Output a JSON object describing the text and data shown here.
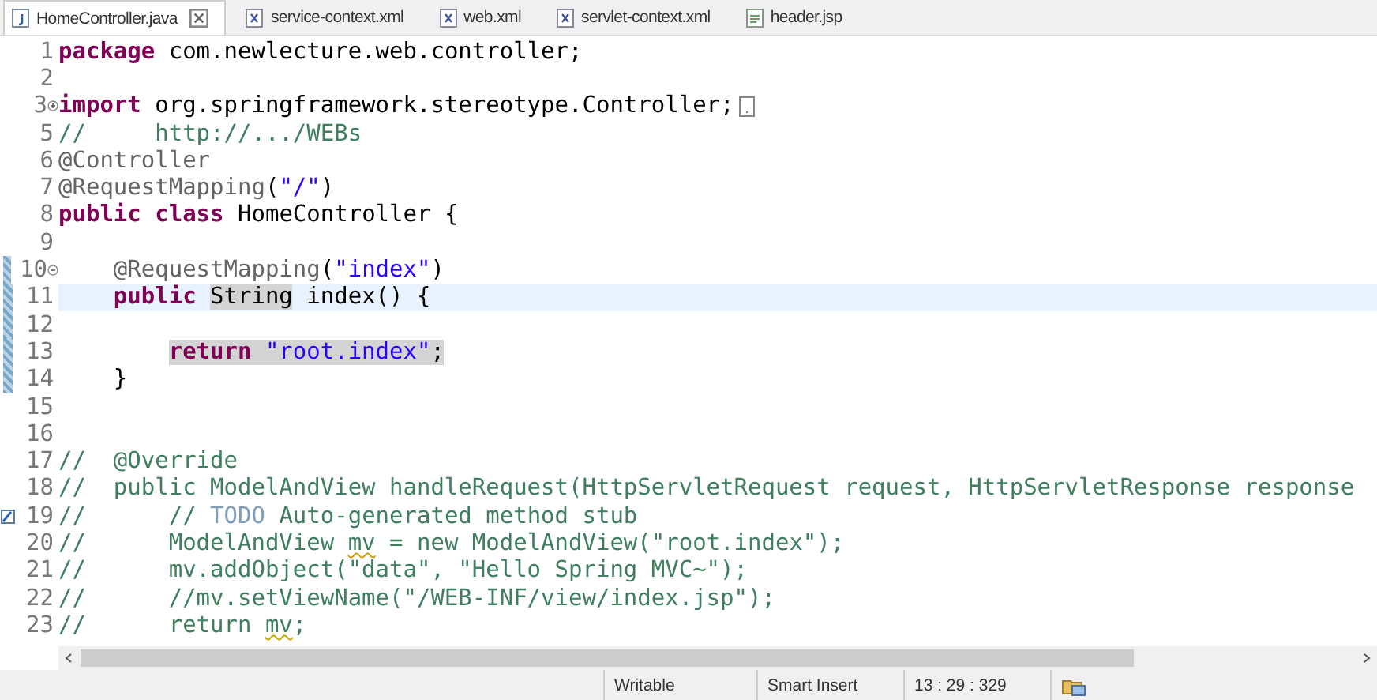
{
  "tabs": [
    {
      "label": "HomeController.java",
      "kind": "java",
      "selected": true
    },
    {
      "label": "service-context.xml",
      "kind": "xml",
      "selected": false
    },
    {
      "label": "web.xml",
      "kind": "xml",
      "selected": false
    },
    {
      "label": "servlet-context.xml",
      "kind": "xml",
      "selected": false
    },
    {
      "label": "header.jsp",
      "kind": "jsp",
      "selected": false
    }
  ],
  "editor": {
    "lines": [
      {
        "number": "1",
        "current": false,
        "changed": false,
        "tokens": [
          {
            "kind": "kw",
            "text": "package ",
            "highlighted": false,
            "warning": false
          },
          {
            "kind": "plain",
            "text": "com.newlecture.web.controller;",
            "highlighted": false,
            "warning": false
          }
        ]
      },
      {
        "number": "2",
        "current": false,
        "changed": false
      },
      {
        "number": "3",
        "current": false,
        "changed": false,
        "collapsed": true,
        "tokens": [
          {
            "kind": "kw",
            "text": "import ",
            "highlighted": false,
            "warning": false
          },
          {
            "kind": "plain",
            "text": "org.springframework.stereotype.Controller;",
            "highlighted": false,
            "warning": false
          }
        ]
      },
      {
        "number": "5",
        "current": false,
        "changed": false,
        "tokens": [
          {
            "kind": "comment",
            "text": "//     http://.../WEBs",
            "highlighted": false,
            "warning": false
          }
        ]
      },
      {
        "number": "6",
        "current": false,
        "changed": false,
        "tokens": [
          {
            "kind": "ann",
            "text": "@Controller",
            "highlighted": false,
            "warning": false
          }
        ]
      },
      {
        "number": "7",
        "current": false,
        "changed": false,
        "tokens": [
          {
            "kind": "ann",
            "text": "@RequestMapping",
            "highlighted": false,
            "warning": false
          },
          {
            "kind": "plain",
            "text": "(",
            "highlighted": false,
            "warning": false
          },
          {
            "kind": "str",
            "text": "\"/\"",
            "highlighted": false,
            "warning": false
          },
          {
            "kind": "plain",
            "text": ")",
            "highlighted": false,
            "warning": false
          }
        ]
      },
      {
        "number": "8",
        "current": false,
        "changed": false,
        "tokens": [
          {
            "kind": "kw",
            "text": "public class ",
            "highlighted": false,
            "warning": false
          },
          {
            "kind": "plain",
            "text": "HomeController {",
            "highlighted": false,
            "warning": false
          }
        ]
      },
      {
        "number": "9",
        "current": false,
        "changed": false
      },
      {
        "number": "10",
        "current": false,
        "changed": true,
        "collapsed": false,
        "tokens": [
          {
            "kind": "ann",
            "text": "    @RequestMapping",
            "highlighted": false,
            "warning": false
          },
          {
            "kind": "plain",
            "text": "(",
            "highlighted": false,
            "warning": false
          },
          {
            "kind": "str",
            "text": "\"index\"",
            "highlighted": false,
            "warning": false
          },
          {
            "kind": "plain",
            "text": ")",
            "highlighted": false,
            "warning": false
          }
        ]
      },
      {
        "number": "11",
        "current": true,
        "changed": true,
        "tokens": [
          {
            "kind": "kw",
            "text": "    public ",
            "highlighted": false,
            "warning": false
          },
          {
            "kind": "plain",
            "text": "String",
            "highlighted": true,
            "warning": false
          },
          {
            "kind": "plain",
            "text": " index() {",
            "highlighted": false,
            "warning": false
          }
        ]
      },
      {
        "number": "12",
        "current": false,
        "changed": true
      },
      {
        "number": "13",
        "current": false,
        "changed": true,
        "tokens": [
          {
            "kind": "kw",
            "text": "        return ",
            "highlighted": true,
            "warning": false
          },
          {
            "kind": "str",
            "text": "\"root.index\"",
            "highlighted": true,
            "warning": false
          },
          {
            "kind": "plain",
            "text": ";",
            "highlighted": true,
            "warning": false
          }
        ]
      },
      {
        "number": "14",
        "current": false,
        "changed": true,
        "tokens": [
          {
            "kind": "plain",
            "text": "    }",
            "highlighted": false,
            "warning": false
          }
        ]
      },
      {
        "number": "15",
        "current": false,
        "changed": false
      },
      {
        "number": "16",
        "current": false,
        "changed": false
      },
      {
        "number": "17",
        "current": false,
        "changed": false,
        "tokens": [
          {
            "kind": "comment",
            "text": "//  @Override",
            "highlighted": false,
            "warning": false
          }
        ]
      },
      {
        "number": "18",
        "current": false,
        "changed": false,
        "tokens": [
          {
            "kind": "comment",
            "text": "//  public ModelAndView handleRequest(HttpServletRequest request, HttpServletResponse response",
            "highlighted": false,
            "warning": false
          }
        ]
      },
      {
        "number": "19",
        "current": false,
        "changed": false,
        "task": true,
        "tokens": [
          {
            "kind": "comment",
            "text": "//      // ",
            "highlighted": false,
            "warning": false
          },
          {
            "kind": "todo",
            "text": "TODO",
            "highlighted": false,
            "warning": false
          },
          {
            "kind": "comment",
            "text": " Auto-generated method stub",
            "highlighted": false,
            "warning": false
          }
        ]
      },
      {
        "number": "20",
        "current": false,
        "changed": false,
        "tokens": [
          {
            "kind": "comment",
            "text": "//      ModelAndView ",
            "highlighted": false,
            "warning": false
          },
          {
            "kind": "comment",
            "text": "mv",
            "highlighted": false,
            "warning": true
          },
          {
            "kind": "comment",
            "text": " = new ModelAndView(\"root.index\");",
            "highlighted": false,
            "warning": false
          }
        ]
      },
      {
        "number": "21",
        "current": false,
        "changed": false,
        "tokens": [
          {
            "kind": "comment",
            "text": "//      mv.addObject(\"data\", \"Hello Spring MVC~\");",
            "highlighted": false,
            "warning": false
          }
        ]
      },
      {
        "number": "22",
        "current": false,
        "changed": false,
        "tokens": [
          {
            "kind": "comment",
            "text": "//      //mv.setViewName(\"/WEB-INF/view/index.jsp\");",
            "highlighted": false,
            "warning": false
          }
        ]
      },
      {
        "number": "23",
        "current": false,
        "changed": false,
        "tokens": [
          {
            "kind": "comment",
            "text": "//      return ",
            "highlighted": false,
            "warning": false
          },
          {
            "kind": "comment",
            "text": "mv",
            "highlighted": false,
            "warning": true
          },
          {
            "kind": "comment",
            "text": ";",
            "highlighted": false,
            "warning": false
          }
        ]
      }
    ]
  },
  "status_bar": [
    "Writable",
    "Smart Insert",
    "13 : 29 : 329"
  ]
}
